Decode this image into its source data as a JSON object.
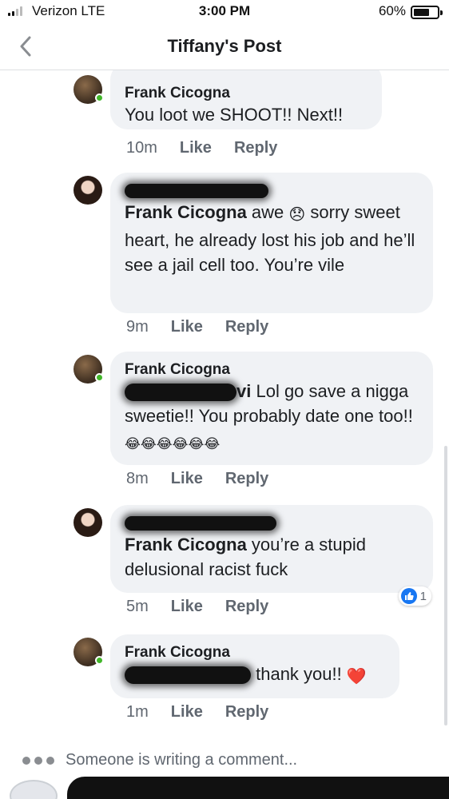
{
  "status_bar": {
    "carrier": "Verizon  LTE",
    "time": "3:00 PM",
    "battery": "60%",
    "battery_level": 0.6
  },
  "nav": {
    "back_icon": "chevron-left-icon",
    "title": "Tiffany's Post"
  },
  "comments": [
    {
      "author": "Frank Cicogna",
      "text": "You loot we SHOOT!! Next!!",
      "time": "10m",
      "like": "Like",
      "reply": "Reply"
    },
    {
      "author_redacted": true,
      "mention": "Frank Cicogna",
      "text_before_emoji": " awe ",
      "emoji": "😞",
      "text_after_emoji": " sorry sweet heart, he already lost his job and he’ll see a jail cell too. You’re vile",
      "time": "9m",
      "like": "Like",
      "reply": "Reply"
    },
    {
      "author": "Frank Cicogna",
      "mention_suffix": "vi",
      "text": "  Lol go save a nigga sweetie!! You probably date one too!! ",
      "emojis": "😂😂😂😂😂😂",
      "time": "8m",
      "like": "Like",
      "reply": "Reply"
    },
    {
      "author_redacted": true,
      "mention": "Frank Cicogna",
      "text": " you’re a stupid delusional racist fuck",
      "time": "5m",
      "like": "Like",
      "reply": "Reply",
      "reaction_count": "1"
    },
    {
      "author": "Frank Cicogna",
      "text": " thank you!! ",
      "emoji": "❤️",
      "time": "1m",
      "like": "Like",
      "reply": "Reply"
    }
  ],
  "typing_indicator": "Someone is writing a comment..."
}
